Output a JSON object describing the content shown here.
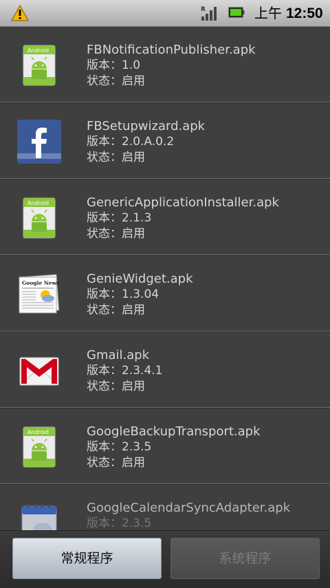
{
  "status_bar": {
    "warning_icon": "warning-triangle-icon",
    "signal_icon": "signal-roaming-icon",
    "battery_icon": "battery-icon",
    "ampm": "上午",
    "time": "12:50"
  },
  "app_list": {
    "items": [
      {
        "name": "FBNotificationPublisher.apk",
        "version": "版本：1.0",
        "status": "状态：启用",
        "icon": "android-package-icon"
      },
      {
        "name": "FBSetupwizard.apk",
        "version": "版本：2.0.A.0.2",
        "status": "状态：启用",
        "icon": "facebook-icon"
      },
      {
        "name": "GenericApplicationInstaller.apk",
        "version": "版本：2.1.3",
        "status": "状态：启用",
        "icon": "android-package-icon"
      },
      {
        "name": "GenieWidget.apk",
        "version": "版本：1.3.04",
        "status": "状态：启用",
        "icon": "google-news-icon"
      },
      {
        "name": "Gmail.apk",
        "version": "版本：2.3.4.1",
        "status": "状态：启用",
        "icon": "gmail-icon"
      },
      {
        "name": "GoogleBackupTransport.apk",
        "version": "版本：2.3.5",
        "status": "状态：启用",
        "icon": "android-package-icon"
      },
      {
        "name": "GoogleCalendarSyncAdapter.apk",
        "version": "版本：2.3.5",
        "status": "",
        "icon": "calendar-icon"
      }
    ]
  },
  "bottom_bar": {
    "regular_label": "常规程序",
    "system_label": "系统程序"
  },
  "colors": {
    "android_green": "#8cc63f",
    "facebook_blue": "#3b5998",
    "gmail_red": "#d0021b"
  }
}
